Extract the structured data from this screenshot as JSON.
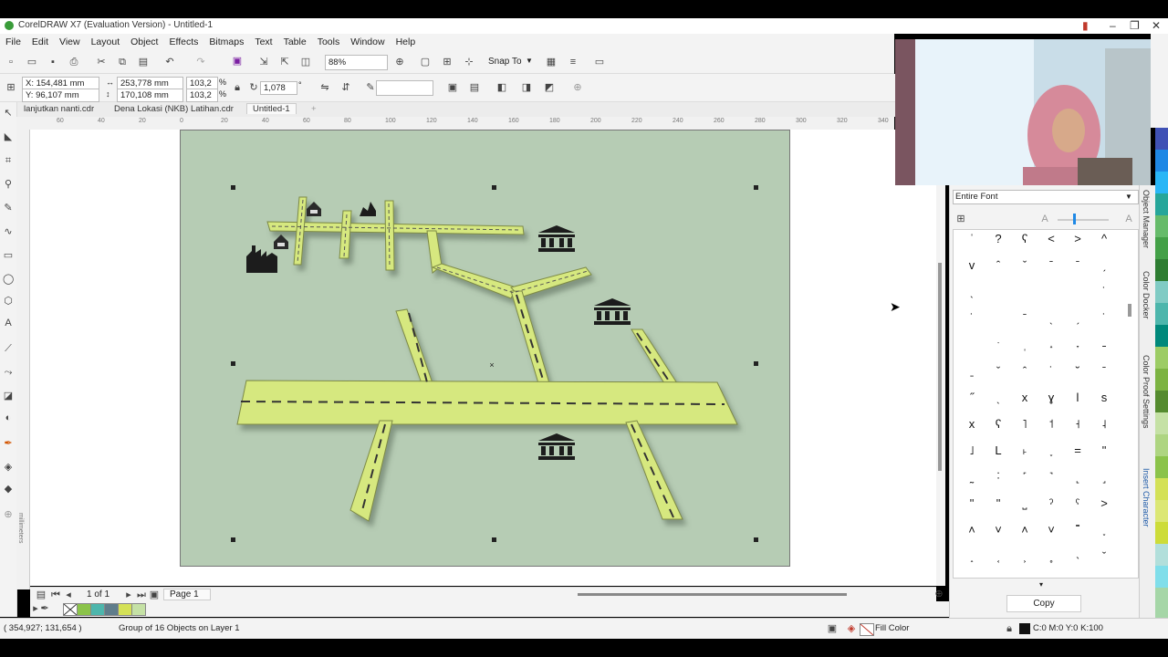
{
  "window": {
    "title": "CorelDRAW X7 (Evaluation Version) - Untitled-1"
  },
  "menu": [
    "File",
    "Edit",
    "View",
    "Layout",
    "Object",
    "Effects",
    "Bitmaps",
    "Text",
    "Table",
    "Tools",
    "Window",
    "Help"
  ],
  "toolbar": {
    "zoom": "88%",
    "snap_to": "Snap To"
  },
  "property_bar": {
    "x": "X: 154,481 mm",
    "y": "Y: 96,107 mm",
    "w": "253,778 mm",
    "h": "170,108 mm",
    "scale_w": "103,2",
    "scale_h": "103,2",
    "pct": "%",
    "rotation": "1,078",
    "deg": "°"
  },
  "doc_tabs": [
    "lanjutkan nanti.cdr",
    "Dena Lokasi (NKB) Latihan.cdr",
    "Untitled-1"
  ],
  "ruler_h": [
    "60",
    "40",
    "20",
    "0",
    "20",
    "40",
    "60",
    "80",
    "100",
    "120",
    "140",
    "160",
    "180",
    "200",
    "220",
    "240",
    "260",
    "280",
    "300",
    "320",
    "340"
  ],
  "ruler_v_unit": "millimeters",
  "page_nav": {
    "count": "1 of 1",
    "page_tab": "Page 1"
  },
  "palette_colors": [
    "#8bc34a",
    "#4db6ac",
    "#607d8b",
    "#d4e157",
    "#c5e1a5"
  ],
  "status": {
    "coords": "( 354,927; 131,654 )",
    "selection": "Group of 16 Objects on Layer 1",
    "fill": "Fill Color",
    "outline": "C:0 M:0 Y:0 K:100"
  },
  "docker": {
    "font_filter": "Entire Font",
    "copy_label": "Copy",
    "chars": [
      "ˈ",
      "?",
      "ʕ",
      "<",
      ">",
      "^",
      "v",
      "ˆ",
      "ˇ",
      "ˉ",
      "ˉ",
      "ˏ",
      "ˎ",
      "",
      "",
      "",
      "",
      "˙",
      "˙",
      "",
      "ˉ",
      "ˎ",
      "ˏ",
      "˙",
      "",
      "ˑ",
      "ˌ",
      "˔",
      "˕",
      "˗",
      "ˍ",
      "ˇ",
      "ˆ",
      "˙",
      "˘",
      "ˉ",
      "˝",
      "ˎ",
      "x",
      "ɣ",
      "l",
      "s",
      "x",
      "ʕ",
      "˥",
      "˦",
      "˧",
      "˨",
      "˩",
      "L",
      "˫",
      "˯",
      "=",
      "\"",
      "˷",
      "˸",
      "˹",
      "˺",
      "˻",
      "˼",
      "\"",
      "\"",
      "˽",
      "ˀ",
      "ˁ",
      "˃",
      "˄",
      "˅",
      "˄",
      "˅",
      "˭",
      "˯",
      "˰",
      "˱",
      "˲",
      "˳",
      "˴",
      "ˇ",
      "ˍ",
      "",
      ""
    ],
    "tabs": [
      "Object Manager",
      "Color Docker",
      "Color Proof Settings",
      "Insert Character"
    ]
  },
  "map_icons": [
    "museum-icon",
    "factory-icon",
    "building-icon",
    "house-icon"
  ]
}
